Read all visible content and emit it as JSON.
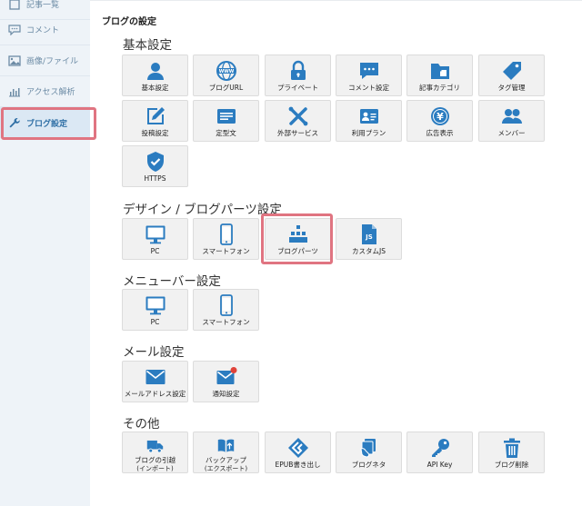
{
  "sidebar": {
    "items": [
      {
        "label": "記事一覧",
        "icon": "article-icon"
      },
      {
        "label": "コメント",
        "icon": "comment-icon"
      },
      {
        "label": "画像/ファイル",
        "icon": "image-icon"
      },
      {
        "label": "アクセス解析",
        "icon": "bar-chart-icon"
      },
      {
        "label": "ブログ設定",
        "icon": "wrench-icon",
        "active": true
      }
    ]
  },
  "page_title": "ブログの設定",
  "sections": {
    "basic": {
      "title": "基本設定",
      "tiles": [
        {
          "label": "基本設定",
          "icon": "user-icon"
        },
        {
          "label": "ブログURL",
          "icon": "www-globe-icon"
        },
        {
          "label": "プライベート",
          "icon": "lock-icon"
        },
        {
          "label": "コメント設定",
          "icon": "comment-bubble-icon"
        },
        {
          "label": "記事カテゴリ",
          "icon": "folder-icon"
        },
        {
          "label": "タグ管理",
          "icon": "tag-icon"
        },
        {
          "label": "投稿設定",
          "icon": "pencil-icon"
        },
        {
          "label": "定型文",
          "icon": "text-template-icon"
        },
        {
          "label": "外部サービス",
          "icon": "external-service-icon"
        },
        {
          "label": "利用プラン",
          "icon": "id-card-icon"
        },
        {
          "label": "広告表示",
          "icon": "yen-coin-icon"
        },
        {
          "label": "メンバー",
          "icon": "members-icon"
        },
        {
          "label": "HTTPS",
          "icon": "shield-check-icon"
        }
      ]
    },
    "design": {
      "title": "デザイン / ブログパーツ設定",
      "tiles": [
        {
          "label": "PC",
          "icon": "monitor-icon"
        },
        {
          "label": "スマートフォン",
          "icon": "smartphone-icon"
        },
        {
          "label": "ブログパーツ",
          "icon": "blog-parts-icon",
          "highlighted": true
        },
        {
          "label": "カスタムJS",
          "icon": "js-file-icon"
        }
      ]
    },
    "menubar": {
      "title": "メニューバー設定",
      "tiles": [
        {
          "label": "PC",
          "icon": "monitor-icon"
        },
        {
          "label": "スマートフォン",
          "icon": "smartphone-icon"
        }
      ]
    },
    "mail": {
      "title": "メール設定",
      "tiles": [
        {
          "label": "メールアドレス設定",
          "icon": "mail-icon"
        },
        {
          "label": "通知設定",
          "icon": "mail-notification-icon"
        }
      ]
    },
    "other": {
      "title": "その他",
      "tiles": [
        {
          "label": "ブログの引越",
          "sub": "(インポート)",
          "icon": "moving-truck-icon"
        },
        {
          "label": "バックアップ",
          "sub": "(エクスポート)",
          "icon": "backup-book-icon"
        },
        {
          "label": "EPUB書き出し",
          "icon": "epub-icon"
        },
        {
          "label": "ブログネタ",
          "icon": "blog-neta-icon"
        },
        {
          "label": "API Key",
          "icon": "key-icon"
        },
        {
          "label": "ブログ削除",
          "icon": "trash-icon"
        }
      ]
    }
  },
  "colors": {
    "accent": "#2b7cc0",
    "highlight": "#e07481",
    "sidebar_bg": "#eef3f8",
    "notification_dot": "#e0433a"
  }
}
